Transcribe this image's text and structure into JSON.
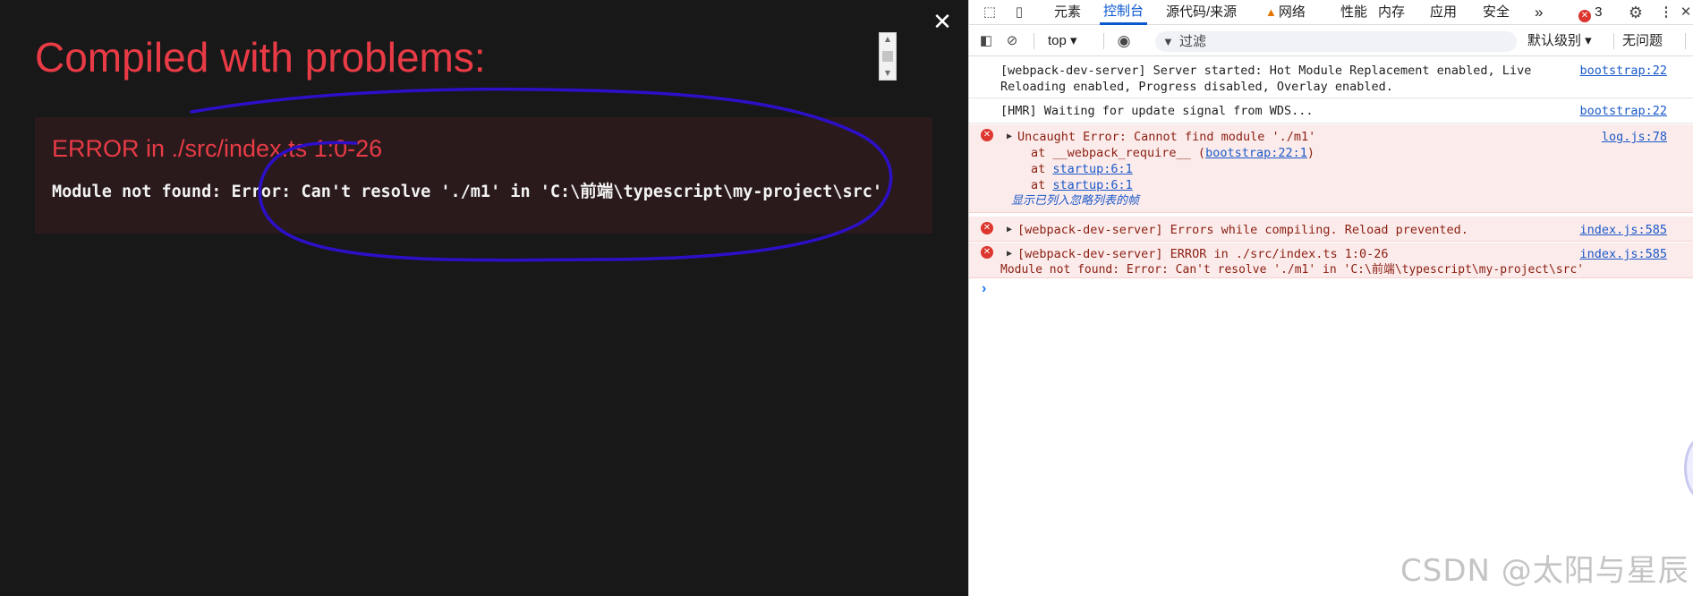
{
  "overlay": {
    "close_label": "✕",
    "title": "Compiled with problems:",
    "error_heading": "ERROR in ./src/index.ts 1:0-26",
    "error_message": "Module not found: Error: Can't resolve './m1' in 'C:\\前端\\typescript\\my-project\\src'",
    "annotation_color": "#2d0fc8"
  },
  "devtools": {
    "tabs": [
      {
        "label": "元素"
      },
      {
        "label": "控制台",
        "active": true
      },
      {
        "label": "源代码/来源"
      },
      {
        "label": "网络",
        "warning": true
      },
      {
        "label": "性能"
      },
      {
        "label": "内存"
      },
      {
        "label": "应用"
      },
      {
        "label": "安全"
      }
    ],
    "more_tabs": "»",
    "error_count": "3",
    "toolbar": {
      "context": "top ▾",
      "filter_placeholder": "过滤",
      "log_level": "默认级别 ▾",
      "issues": "无问题"
    },
    "messages": [
      {
        "type": "log",
        "lines": [
          "[webpack-dev-server] Server started: Hot Module Replacement enabled, Live",
          "Reloading enabled, Progress disabled, Overlay enabled."
        ],
        "source": "bootstrap:22"
      },
      {
        "type": "log",
        "lines": [
          "[HMR] Waiting for update signal from WDS..."
        ],
        "source": "bootstrap:22"
      },
      {
        "type": "error",
        "lines": [
          "Uncaught Error: Cannot find module './m1'"
        ],
        "stack": [
          {
            "prefix": "at __webpack_require__ (",
            "link": "bootstrap:22:1",
            "suffix": ")"
          },
          {
            "prefix": "at ",
            "link": "startup:6:1",
            "suffix": ""
          },
          {
            "prefix": "at ",
            "link": "startup:6:1",
            "suffix": ""
          }
        ],
        "ignore_list_link": "显示已列入忽略列表的帧",
        "source": "log.js:78"
      },
      {
        "type": "error",
        "lines": [
          "[webpack-dev-server] Errors while compiling. Reload prevented."
        ],
        "source": "index.js:585"
      },
      {
        "type": "error",
        "lines": [
          "[webpack-dev-server] ERROR in ./src/index.ts 1:0-26",
          "Module not found: Error: Can't resolve './m1' in 'C:\\前端\\typescript\\my-project\\src'"
        ],
        "source": "index.js:585"
      }
    ],
    "prompt": "›"
  },
  "watermark": "CSDN @太阳与星辰"
}
